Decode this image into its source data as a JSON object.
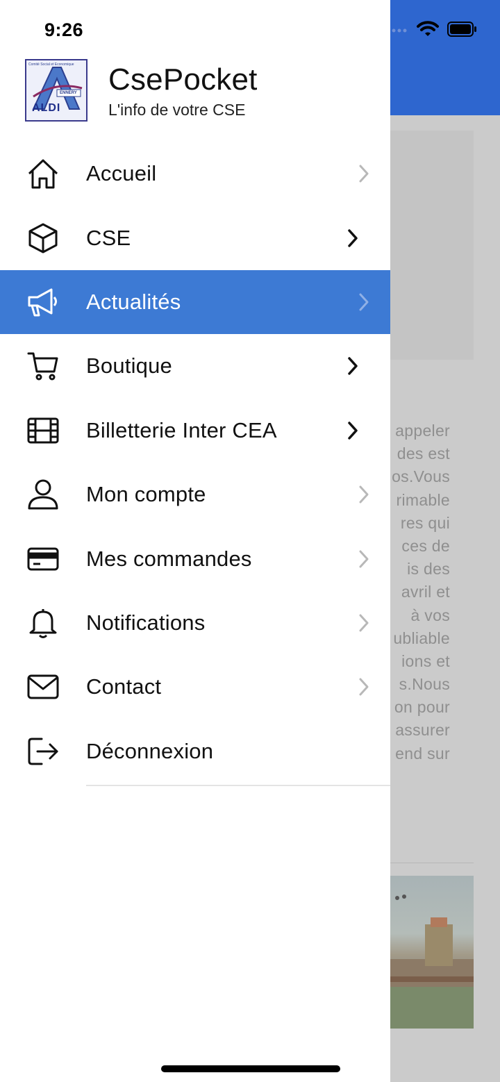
{
  "status": {
    "time": "9:26"
  },
  "brand": {
    "app_name": "CsePocket",
    "tagline": "L'info de votre CSE",
    "logo_text": "ALDI",
    "logo_caption": "Comité Social et Economique",
    "logo_sub": "ENNERY"
  },
  "menu": {
    "items": [
      {
        "label": "Accueil",
        "icon": "home-icon",
        "active": false,
        "chevron": "light"
      },
      {
        "label": "CSE",
        "icon": "cube-icon",
        "active": false,
        "chevron": "strong"
      },
      {
        "label": "Actualités",
        "icon": "megaphone-icon",
        "active": true,
        "chevron": "light"
      },
      {
        "label": "Boutique",
        "icon": "cart-icon",
        "active": false,
        "chevron": "strong"
      },
      {
        "label": "Billetterie Inter CEA",
        "icon": "film-icon",
        "active": false,
        "chevron": "strong"
      },
      {
        "label": "Mon compte",
        "icon": "user-icon",
        "active": false,
        "chevron": "light"
      },
      {
        "label": "Mes commandes",
        "icon": "credit-card-icon",
        "active": false,
        "chevron": "light"
      },
      {
        "label": "Notifications",
        "icon": "bell-icon",
        "active": false,
        "chevron": "light"
      },
      {
        "label": "Contact",
        "icon": "mail-icon",
        "active": false,
        "chevron": "light"
      },
      {
        "label": "Déconnexion",
        "icon": "logout-icon",
        "active": false,
        "chevron": "none"
      }
    ]
  },
  "background": {
    "text_lines": [
      "appeler",
      "des est",
      "os.Vous",
      "rimable",
      "res qui",
      "ces de",
      "is des",
      "avril et",
      "à vos",
      "ubliable",
      "ions et",
      "s.Nous",
      "on pour",
      "assurer",
      "end sur"
    ]
  },
  "colors": {
    "accent": "#3d7ad4",
    "header": "#2e66cf",
    "overlay": "#cbcbcb"
  }
}
